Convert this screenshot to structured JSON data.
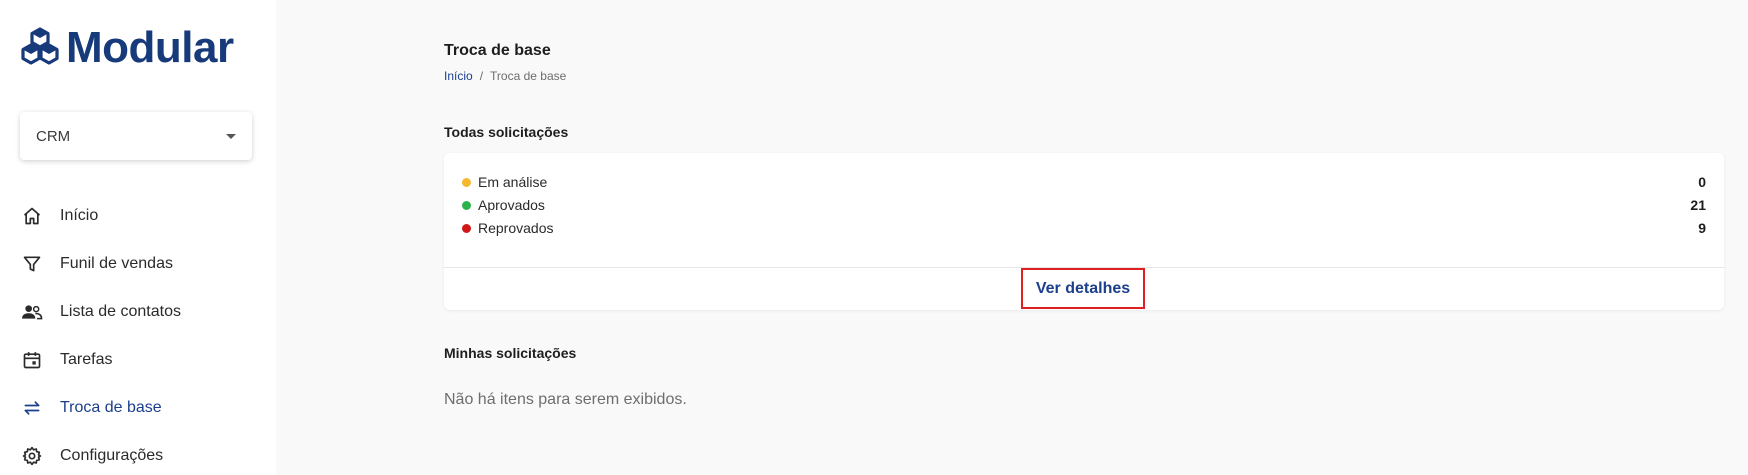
{
  "brand": {
    "name": "Modular",
    "color": "#173a7a"
  },
  "module_select": {
    "value": "CRM"
  },
  "nav": {
    "items": [
      {
        "label": "Início",
        "icon": "home-icon"
      },
      {
        "label": "Funil de vendas",
        "icon": "funnel-icon"
      },
      {
        "label": "Lista de contatos",
        "icon": "contacts-icon"
      },
      {
        "label": "Tarefas",
        "icon": "calendar-icon"
      },
      {
        "label": "Troca de base",
        "icon": "swap-icon",
        "active": true
      },
      {
        "label": "Configurações",
        "icon": "gear-icon"
      }
    ],
    "active_color": "#1b3f8b"
  },
  "page": {
    "title": "Troca de base",
    "breadcrumb": {
      "home": "Início",
      "separator": "/",
      "current": "Troca de base"
    }
  },
  "all_requests": {
    "title": "Todas solicitações",
    "statuses": [
      {
        "label": "Em análise",
        "count": "0",
        "color": "#f5b82e"
      },
      {
        "label": "Aprovados",
        "count": "21",
        "color": "#2bb24c"
      },
      {
        "label": "Reprovados",
        "count": "9",
        "color": "#d01818"
      }
    ],
    "details_button": "Ver detalhes"
  },
  "my_requests": {
    "title": "Minhas solicitações",
    "empty_message": "Não há itens para serem exibidos."
  }
}
